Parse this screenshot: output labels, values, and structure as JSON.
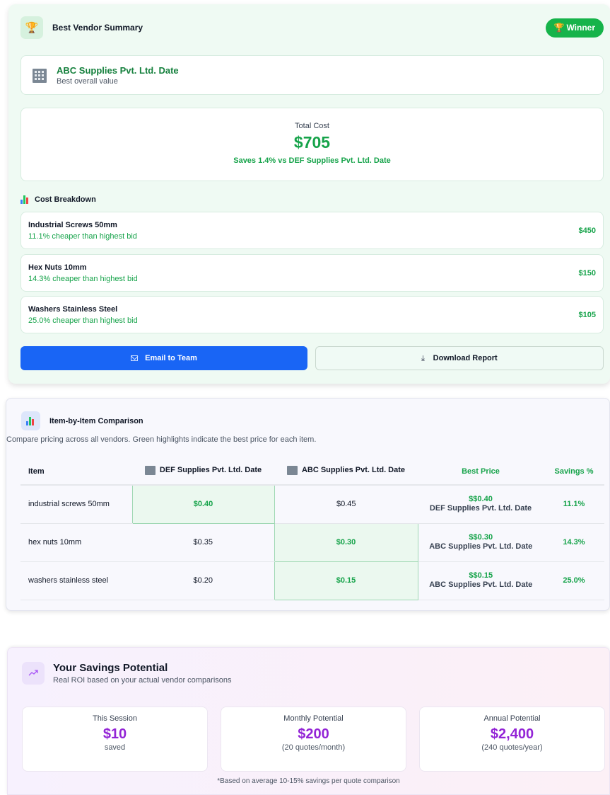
{
  "summary": {
    "title": "Best Vendor Summary",
    "badge": "Winner",
    "vendor_name": "ABC Supplies Pvt. Ltd. Date",
    "vendor_sub": "Best overall value",
    "total_label": "Total Cost",
    "total_value": "$705",
    "savings_note": "Saves 1.4% vs DEF Supplies Pvt. Ltd. Date",
    "breakdown_title": "Cost Breakdown",
    "breakdown": [
      {
        "name": "Industrial Screws 50mm",
        "note": "11.1% cheaper than highest bid",
        "amount": "$450"
      },
      {
        "name": "Hex Nuts 10mm",
        "note": "14.3% cheaper than highest bid",
        "amount": "$150"
      },
      {
        "name": "Washers Stainless Steel",
        "note": "25.0% cheaper than highest bid",
        "amount": "$105"
      }
    ],
    "email_button": "Email to Team",
    "download_button": "Download Report"
  },
  "comparison": {
    "title": "Item-by-Item Comparison",
    "description": "Compare pricing across all vendors. Green highlights indicate the best price for each item.",
    "columns": {
      "item": "Item",
      "vendor_a": "DEF Supplies Pvt. Ltd. Date",
      "vendor_b": "ABC Supplies Pvt. Ltd. Date",
      "best": "Best Price",
      "savings": "Savings %"
    },
    "rows": [
      {
        "item": "industrial screws 50mm",
        "a": "$0.40",
        "b": "$0.45",
        "best_price": "$$0.40",
        "best_vendor": "DEF Supplies Pvt. Ltd. Date",
        "savings": "11.1%"
      },
      {
        "item": "hex nuts 10mm",
        "a": "$0.35",
        "b": "$0.30",
        "best_price": "$$0.30",
        "best_vendor": "ABC Supplies Pvt. Ltd. Date",
        "savings": "14.3%"
      },
      {
        "item": "washers stainless steel",
        "a": "$0.20",
        "b": "$0.15",
        "best_price": "$$0.15",
        "best_vendor": "ABC Supplies Pvt. Ltd. Date",
        "savings": "25.0%"
      }
    ]
  },
  "savings": {
    "title": "Your Savings Potential",
    "subtitle": "Real ROI based on your actual vendor comparisons",
    "stats": [
      {
        "label": "This Session",
        "value": "$10",
        "sub": "saved"
      },
      {
        "label": "Monthly Potential",
        "value": "$200",
        "sub": "(20 quotes/month)"
      },
      {
        "label": "Annual Potential",
        "value": "$2,400",
        "sub": "(240 quotes/year)"
      }
    ],
    "footnote": "*Based on average 10-15% savings per quote comparison"
  },
  "icons": {
    "trophy": "trophy-icon",
    "building": "building-icon",
    "chart": "bar-chart-icon",
    "mail": "mail-icon",
    "download": "download-icon",
    "trend": "trending-up-icon"
  },
  "colors": {
    "green": "#16a34a",
    "blue_button": "#1965f5",
    "purple": "#9324d6"
  }
}
